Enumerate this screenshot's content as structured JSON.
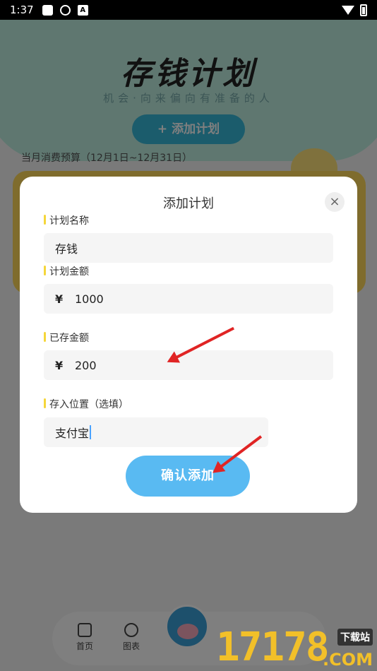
{
  "status_bar": {
    "time": "1:37",
    "icon_letter": "A"
  },
  "background": {
    "hero_title": "存钱计划",
    "hero_subtitle": "机会·向来偏向有准备的人",
    "add_plan_button": "+ 添加计划",
    "budget_label": "当月消费预算（12月1日~12月31日）",
    "nav": {
      "home": "首页",
      "chart": "图表"
    },
    "colors": {
      "hero": "#bfeee0",
      "card": "#ffd95a",
      "accent": "#37b8d8"
    }
  },
  "dialog": {
    "title": "添加计划",
    "close_icon": "close-icon",
    "fields": {
      "name": {
        "label": "计划名称",
        "value": "存钱"
      },
      "amount": {
        "label": "计划金额",
        "currency": "¥",
        "value": "1000"
      },
      "saved": {
        "label": "已存金额",
        "currency": "¥",
        "value": "200"
      },
      "location": {
        "label": "存入位置（选填）",
        "value": "支付宝"
      }
    },
    "confirm_button": "确认添加",
    "colors": {
      "confirm": "#59baf2",
      "label_marker": "#f5d63a"
    }
  },
  "watermark": {
    "number": "17178",
    "tag": "下载站",
    "domain": ".COM"
  }
}
